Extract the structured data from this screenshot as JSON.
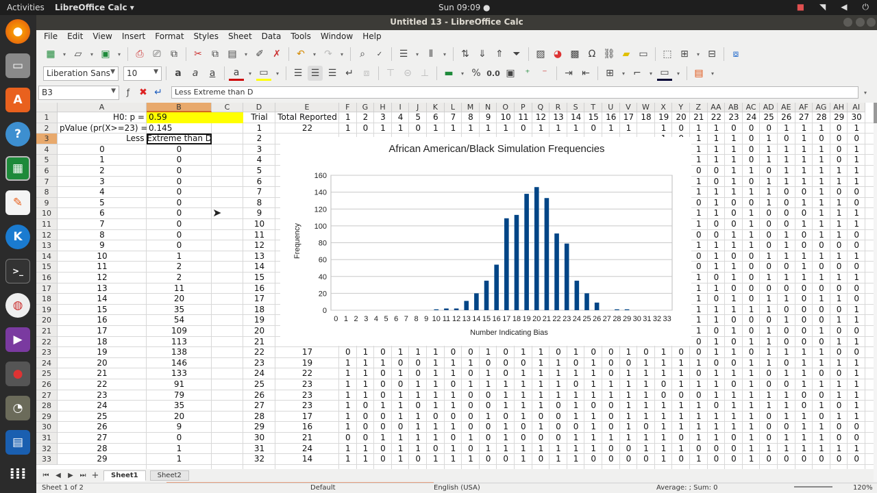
{
  "topbar": {
    "activities": "Activities",
    "app_name": "LibreOffice Calc",
    "app_arrow": "▾",
    "clock": "Sun 09:09 ●",
    "tray_icons": [
      "camera-icon",
      "wifi-icon",
      "volume-icon",
      "power-icon"
    ]
  },
  "window": {
    "title": "Untitled 13 - LibreOffice Calc"
  },
  "menus": [
    "File",
    "Edit",
    "View",
    "Insert",
    "Format",
    "Styles",
    "Sheet",
    "Data",
    "Tools",
    "Window",
    "Help"
  ],
  "formatting": {
    "font_name": "Liberation Sans",
    "font_size": "10",
    "percent_label": "%",
    "decimal_label": "0.0"
  },
  "formula_bar": {
    "name_box": "B3",
    "content": "Less Extreme than D"
  },
  "columns": [
    "A",
    "B",
    "C",
    "D",
    "E",
    "F",
    "G",
    "H",
    "I",
    "J",
    "K",
    "L",
    "M",
    "N",
    "O",
    "P",
    "Q",
    "R",
    "S",
    "T",
    "U",
    "V",
    "W",
    "X",
    "Y",
    "Z",
    "AA",
    "AB",
    "AC",
    "AD",
    "AE",
    "AF",
    "AG",
    "AH",
    "AI"
  ],
  "selected_column": "B",
  "selected_row": 3,
  "rows": [
    {
      "n": 1,
      "A": "H0: p =",
      "B": "0.59",
      "D": "Trial",
      "E": "Total Reported",
      "bits": [
        "1",
        "2",
        "3",
        "4",
        "5",
        "6",
        "7",
        "8",
        "9",
        "10",
        "11",
        "12",
        "13",
        "14",
        "15",
        "16",
        "17",
        "18",
        "19",
        "20",
        "21",
        "22",
        "23",
        "24",
        "25",
        "26",
        "27",
        "28",
        "29",
        "30"
      ]
    },
    {
      "n": 2,
      "A": "pValue (pr(X>=23) =",
      "B": "0.145",
      "D": "1",
      "E": "22",
      "bits": [
        "1",
        "0",
        "1",
        "1",
        "0",
        "1",
        "1",
        "1",
        "1",
        "1",
        "0",
        "1",
        "1",
        "1",
        "0",
        "1",
        "1",
        "",
        "1",
        "0",
        "1",
        "1",
        "0",
        "0",
        "0",
        "1",
        "1",
        "1",
        "0",
        "1"
      ]
    },
    {
      "n": 3,
      "B": "Less Extreme than D",
      "D": "2",
      "bits": [
        "",
        "",
        "",
        "",
        "",
        "",
        "",
        "",
        "",
        "",
        "",
        "",
        "",
        "",
        "",
        "",
        "",
        "",
        "1",
        "0",
        "1",
        "1",
        "1",
        "0",
        "1",
        "0",
        "1",
        "0",
        "0",
        "0"
      ]
    },
    {
      "n": 4,
      "A": "0",
      "B": "0",
      "D": "3",
      "bits": [
        "",
        "",
        "",
        "",
        "",
        "",
        "",
        "",
        "",
        "",
        "",
        "",
        "",
        "",
        "",
        "",
        "",
        "",
        "1",
        "1",
        "1",
        "1",
        "1",
        "0",
        "1",
        "1",
        "1",
        "1",
        "0",
        "1"
      ]
    },
    {
      "n": 5,
      "A": "1",
      "B": "0",
      "D": "4",
      "bits": [
        "",
        "",
        "",
        "",
        "",
        "",
        "",
        "",
        "",
        "",
        "",
        "",
        "",
        "",
        "",
        "",
        "",
        "",
        "1",
        "1",
        "1",
        "1",
        "1",
        "0",
        "1",
        "1",
        "1",
        "1",
        "0",
        "1"
      ]
    },
    {
      "n": 6,
      "A": "2",
      "B": "0",
      "D": "5",
      "bits": [
        "",
        "",
        "",
        "",
        "",
        "",
        "",
        "",
        "",
        "",
        "",
        "",
        "",
        "",
        "",
        "",
        "",
        "",
        "0",
        "0",
        "0",
        "0",
        "1",
        "1",
        "0",
        "1",
        "1",
        "1",
        "1",
        "1"
      ]
    },
    {
      "n": 7,
      "A": "3",
      "B": "0",
      "D": "6",
      "bits": [
        "",
        "",
        "",
        "",
        "",
        "",
        "",
        "",
        "",
        "",
        "",
        "",
        "",
        "",
        "",
        "",
        "",
        "",
        "1",
        "0",
        "1",
        "0",
        "1",
        "0",
        "1",
        "1",
        "1",
        "1",
        "1",
        "1"
      ]
    },
    {
      "n": 8,
      "A": "4",
      "B": "0",
      "D": "7",
      "bits": [
        "",
        "",
        "",
        "",
        "",
        "",
        "",
        "",
        "",
        "",
        "",
        "",
        "",
        "",
        "",
        "",
        "",
        "",
        "1",
        "1",
        "1",
        "1",
        "1",
        "1",
        "1",
        "0",
        "0",
        "1",
        "0",
        "0"
      ]
    },
    {
      "n": 9,
      "A": "5",
      "B": "0",
      "D": "8",
      "bits": [
        "",
        "",
        "",
        "",
        "",
        "",
        "",
        "",
        "",
        "",
        "",
        "",
        "",
        "",
        "",
        "",
        "",
        "",
        "0",
        "0",
        "0",
        "1",
        "0",
        "0",
        "1",
        "0",
        "1",
        "1",
        "1",
        "0"
      ]
    },
    {
      "n": 10,
      "A": "6",
      "B": "0",
      "D": "9",
      "bits": [
        "",
        "",
        "",
        "",
        "",
        "",
        "",
        "",
        "",
        "",
        "",
        "",
        "",
        "",
        "",
        "",
        "",
        "",
        "1",
        "1",
        "1",
        "1",
        "0",
        "1",
        "0",
        "0",
        "0",
        "1",
        "1",
        "1"
      ]
    },
    {
      "n": 11,
      "A": "7",
      "B": "0",
      "D": "10",
      "bits": [
        "",
        "",
        "",
        "",
        "",
        "",
        "",
        "",
        "",
        "",
        "",
        "",
        "",
        "",
        "",
        "",
        "",
        "",
        "1",
        "1",
        "1",
        "0",
        "0",
        "1",
        "0",
        "0",
        "1",
        "1",
        "1",
        "1"
      ]
    },
    {
      "n": 12,
      "A": "8",
      "B": "0",
      "D": "11",
      "bits": [
        "",
        "",
        "",
        "",
        "",
        "",
        "",
        "",
        "",
        "",
        "",
        "",
        "",
        "",
        "",
        "",
        "",
        "",
        "0",
        "0",
        "0",
        "0",
        "1",
        "1",
        "0",
        "1",
        "0",
        "1",
        "1",
        "0"
      ]
    },
    {
      "n": 13,
      "A": "9",
      "B": "0",
      "D": "12",
      "bits": [
        "",
        "",
        "",
        "",
        "",
        "",
        "",
        "",
        "",
        "",
        "",
        "",
        "",
        "",
        "",
        "",
        "",
        "",
        "1",
        "0",
        "1",
        "1",
        "1",
        "1",
        "0",
        "1",
        "0",
        "0",
        "0",
        "0"
      ]
    },
    {
      "n": 14,
      "A": "10",
      "B": "1",
      "D": "13",
      "bits": [
        "",
        "",
        "",
        "",
        "",
        "",
        "",
        "",
        "",
        "",
        "",
        "",
        "",
        "",
        "",
        "",
        "",
        "",
        "0",
        "0",
        "0",
        "1",
        "0",
        "0",
        "1",
        "1",
        "1",
        "1",
        "1",
        "1"
      ]
    },
    {
      "n": 15,
      "A": "11",
      "B": "2",
      "D": "14",
      "bits": [
        "",
        "",
        "",
        "",
        "",
        "",
        "",
        "",
        "",
        "",
        "",
        "",
        "",
        "",
        "",
        "",
        "",
        "",
        "1",
        "0",
        "0",
        "1",
        "1",
        "0",
        "0",
        "0",
        "1",
        "0",
        "0",
        "0"
      ]
    },
    {
      "n": 16,
      "A": "12",
      "B": "2",
      "D": "15",
      "bits": [
        "",
        "",
        "",
        "",
        "",
        "",
        "",
        "",
        "",
        "",
        "",
        "",
        "",
        "",
        "",
        "",
        "",
        "",
        "1",
        "0",
        "1",
        "0",
        "1",
        "0",
        "1",
        "1",
        "1",
        "1",
        "1",
        "1"
      ]
    },
    {
      "n": 17,
      "A": "13",
      "B": "11",
      "D": "16",
      "bits": [
        "",
        "",
        "",
        "",
        "",
        "",
        "",
        "",
        "",
        "",
        "",
        "",
        "",
        "",
        "",
        "",
        "",
        "",
        "1",
        "1",
        "1",
        "1",
        "0",
        "0",
        "0",
        "0",
        "0",
        "0",
        "0",
        "0"
      ]
    },
    {
      "n": 18,
      "A": "14",
      "B": "20",
      "D": "17",
      "bits": [
        "",
        "",
        "",
        "",
        "",
        "",
        "",
        "",
        "",
        "",
        "",
        "",
        "",
        "",
        "",
        "",
        "",
        "",
        "1",
        "0",
        "1",
        "0",
        "1",
        "0",
        "1",
        "1",
        "0",
        "1",
        "1",
        "0"
      ]
    },
    {
      "n": 19,
      "A": "15",
      "B": "35",
      "D": "18",
      "bits": [
        "",
        "",
        "",
        "",
        "",
        "",
        "",
        "",
        "",
        "",
        "",
        "",
        "",
        "",
        "",
        "",
        "",
        "",
        "0",
        "0",
        "1",
        "1",
        "1",
        "1",
        "1",
        "0",
        "0",
        "0",
        "0",
        "1"
      ]
    },
    {
      "n": 20,
      "A": "16",
      "B": "54",
      "D": "19",
      "bits": [
        "",
        "",
        "",
        "",
        "",
        "",
        "",
        "",
        "",
        "",
        "",
        "",
        "",
        "",
        "",
        "",
        "",
        "",
        "1",
        "0",
        "1",
        "1",
        "0",
        "0",
        "0",
        "1",
        "0",
        "0",
        "1",
        "1"
      ]
    },
    {
      "n": 21,
      "A": "17",
      "B": "109",
      "D": "20",
      "bits": [
        "",
        "",
        "",
        "",
        "",
        "",
        "",
        "",
        "",
        "",
        "",
        "",
        "",
        "",
        "",
        "",
        "",
        "",
        "0",
        "1",
        "1",
        "0",
        "1",
        "0",
        "1",
        "0",
        "0",
        "1",
        "0",
        "0"
      ]
    },
    {
      "n": 22,
      "A": "18",
      "B": "113",
      "D": "21",
      "bits": [
        "",
        "",
        "",
        "",
        "",
        "",
        "",
        "",
        "",
        "",
        "",
        "",
        "",
        "",
        "",
        "",
        "",
        "",
        "1",
        "1",
        "0",
        "1",
        "0",
        "1",
        "1",
        "0",
        "0",
        "0",
        "1",
        "1"
      ]
    },
    {
      "n": 23,
      "A": "19",
      "B": "138",
      "D": "22",
      "E": "17",
      "bits": [
        "0",
        "1",
        "0",
        "1",
        "1",
        "1",
        "0",
        "0",
        "1",
        "0",
        "1",
        "1",
        "0",
        "1",
        "0",
        "0",
        "1",
        "0",
        "1",
        "0",
        "0",
        "1",
        "1",
        "0",
        "1",
        "1",
        "1",
        "1",
        "0",
        "0"
      ]
    },
    {
      "n": 24,
      "A": "20",
      "B": "146",
      "D": "23",
      "E": "19",
      "bits": [
        "1",
        "1",
        "1",
        "0",
        "0",
        "1",
        "1",
        "1",
        "0",
        "0",
        "0",
        "1",
        "1",
        "0",
        "1",
        "0",
        "0",
        "1",
        "1",
        "1",
        "1",
        "0",
        "0",
        "1",
        "1",
        "0",
        "1",
        "1",
        "1",
        "1"
      ]
    },
    {
      "n": 25,
      "A": "21",
      "B": "133",
      "D": "24",
      "E": "22",
      "bits": [
        "1",
        "1",
        "0",
        "1",
        "0",
        "1",
        "1",
        "0",
        "1",
        "0",
        "1",
        "1",
        "1",
        "1",
        "1",
        "0",
        "1",
        "1",
        "1",
        "1",
        "0",
        "1",
        "1",
        "1",
        "0",
        "1",
        "1",
        "0",
        "0",
        "1"
      ]
    },
    {
      "n": 26,
      "A": "22",
      "B": "91",
      "D": "25",
      "E": "23",
      "bits": [
        "1",
        "1",
        "0",
        "0",
        "1",
        "1",
        "0",
        "1",
        "1",
        "1",
        "1",
        "1",
        "1",
        "0",
        "1",
        "1",
        "1",
        "1",
        "0",
        "1",
        "1",
        "1",
        "0",
        "1",
        "0",
        "0",
        "1",
        "1",
        "1",
        "1"
      ]
    },
    {
      "n": 27,
      "A": "23",
      "B": "79",
      "D": "26",
      "E": "23",
      "bits": [
        "1",
        "1",
        "0",
        "1",
        "1",
        "1",
        "1",
        "0",
        "0",
        "1",
        "1",
        "1",
        "1",
        "1",
        "1",
        "1",
        "1",
        "1",
        "0",
        "0",
        "0",
        "1",
        "1",
        "1",
        "1",
        "1",
        "0",
        "0",
        "1",
        "1"
      ]
    },
    {
      "n": 28,
      "A": "24",
      "B": "35",
      "D": "27",
      "E": "23",
      "bits": [
        "1",
        "0",
        "1",
        "1",
        "0",
        "1",
        "1",
        "0",
        "0",
        "1",
        "1",
        "1",
        "0",
        "1",
        "0",
        "0",
        "1",
        "1",
        "1",
        "1",
        "1",
        "0",
        "1",
        "1",
        "1",
        "1",
        "0",
        "1",
        "0",
        "1"
      ]
    },
    {
      "n": 29,
      "A": "25",
      "B": "20",
      "D": "28",
      "E": "17",
      "bits": [
        "1",
        "0",
        "0",
        "1",
        "1",
        "0",
        "0",
        "0",
        "1",
        "0",
        "1",
        "0",
        "0",
        "1",
        "1",
        "0",
        "1",
        "1",
        "1",
        "1",
        "1",
        "1",
        "1",
        "1",
        "0",
        "1",
        "1",
        "0",
        "1",
        "1"
      ]
    },
    {
      "n": 30,
      "A": "26",
      "B": "9",
      "D": "29",
      "E": "16",
      "bits": [
        "1",
        "0",
        "0",
        "0",
        "1",
        "1",
        "1",
        "0",
        "0",
        "1",
        "0",
        "1",
        "0",
        "0",
        "1",
        "0",
        "1",
        "0",
        "1",
        "1",
        "1",
        "1",
        "1",
        "1",
        "0",
        "0",
        "1",
        "1",
        "0",
        "0"
      ]
    },
    {
      "n": 31,
      "A": "27",
      "B": "0",
      "D": "30",
      "E": "21",
      "bits": [
        "0",
        "0",
        "1",
        "1",
        "1",
        "1",
        "0",
        "1",
        "0",
        "1",
        "0",
        "0",
        "0",
        "1",
        "1",
        "1",
        "1",
        "1",
        "1",
        "0",
        "1",
        "1",
        "0",
        "1",
        "0",
        "1",
        "1",
        "1",
        "0",
        "0"
      ]
    },
    {
      "n": 32,
      "A": "28",
      "B": "1",
      "D": "31",
      "E": "24",
      "bits": [
        "1",
        "1",
        "0",
        "1",
        "1",
        "0",
        "1",
        "0",
        "1",
        "1",
        "1",
        "1",
        "1",
        "1",
        "1",
        "0",
        "0",
        "1",
        "1",
        "1",
        "0",
        "0",
        "0",
        "1",
        "1",
        "1",
        "1",
        "1",
        "1",
        "1"
      ]
    },
    {
      "n": 33,
      "A": "29",
      "B": "1",
      "D": "32",
      "E": "14",
      "bits": [
        "1",
        "1",
        "0",
        "1",
        "0",
        "1",
        "1",
        "1",
        "0",
        "0",
        "1",
        "0",
        "1",
        "1",
        "0",
        "0",
        "0",
        "0",
        "1",
        "0",
        "1",
        "0",
        "0",
        "1",
        "0",
        "0",
        "0",
        "0",
        "0",
        "0"
      ]
    }
  ],
  "sheet_tabs": [
    "Sheet1",
    "Sheet2"
  ],
  "active_tab": "Sheet1",
  "status": {
    "sheet_info": "Sheet 1 of 2",
    "page_style": "Default",
    "language": "English (USA)",
    "sum": "Average: ; Sum: 0",
    "zoom": "120%"
  },
  "chart_data": {
    "type": "bar",
    "title": "African American/Black Simulation Frequencies",
    "xlabel": "Number Indicating Bias",
    "ylabel": "Frequency",
    "ylim": [
      0,
      160
    ],
    "yticks": [
      0,
      20,
      40,
      60,
      80,
      100,
      120,
      140,
      160
    ],
    "categories": [
      "0",
      "1",
      "2",
      "3",
      "4",
      "5",
      "6",
      "7",
      "8",
      "9",
      "10",
      "11",
      "12",
      "13",
      "14",
      "15",
      "16",
      "17",
      "18",
      "19",
      "20",
      "21",
      "22",
      "23",
      "24",
      "25",
      "26",
      "27",
      "28",
      "29",
      "30",
      "31",
      "32",
      "33"
    ],
    "values": [
      0,
      0,
      0,
      0,
      0,
      0,
      0,
      0,
      0,
      0,
      1,
      2,
      2,
      11,
      20,
      35,
      54,
      109,
      113,
      138,
      146,
      133,
      91,
      79,
      35,
      20,
      9,
      0,
      1,
      1,
      0,
      0,
      0,
      0
    ],
    "color": "#004586"
  }
}
